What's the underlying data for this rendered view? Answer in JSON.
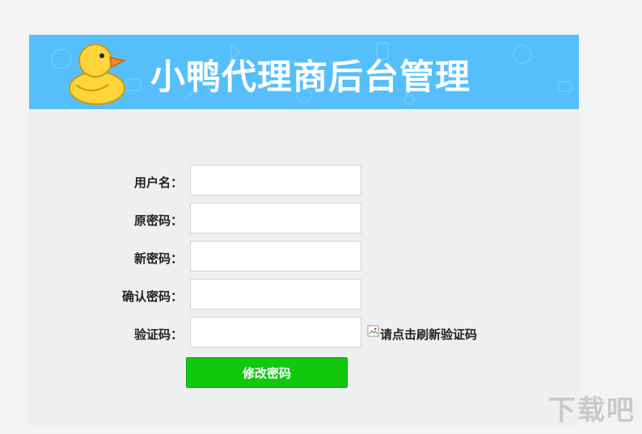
{
  "banner": {
    "title": "小鸭代理商后台管理"
  },
  "form": {
    "username_label": "用户名：",
    "old_password_label": "原密码：",
    "new_password_label": "新密码：",
    "confirm_password_label": "确认密码：",
    "captcha_label": "验证码：",
    "username_value": "",
    "old_password_value": "",
    "new_password_value": "",
    "confirm_password_value": "",
    "captcha_value": "",
    "captcha_alt_text": "请点击刷新验证码",
    "submit_label": "修改密码"
  },
  "watermark": {
    "text": "下载吧"
  },
  "colors": {
    "banner": "#55bffc",
    "submit": "#11c80f",
    "panel": "#eeeff0"
  }
}
